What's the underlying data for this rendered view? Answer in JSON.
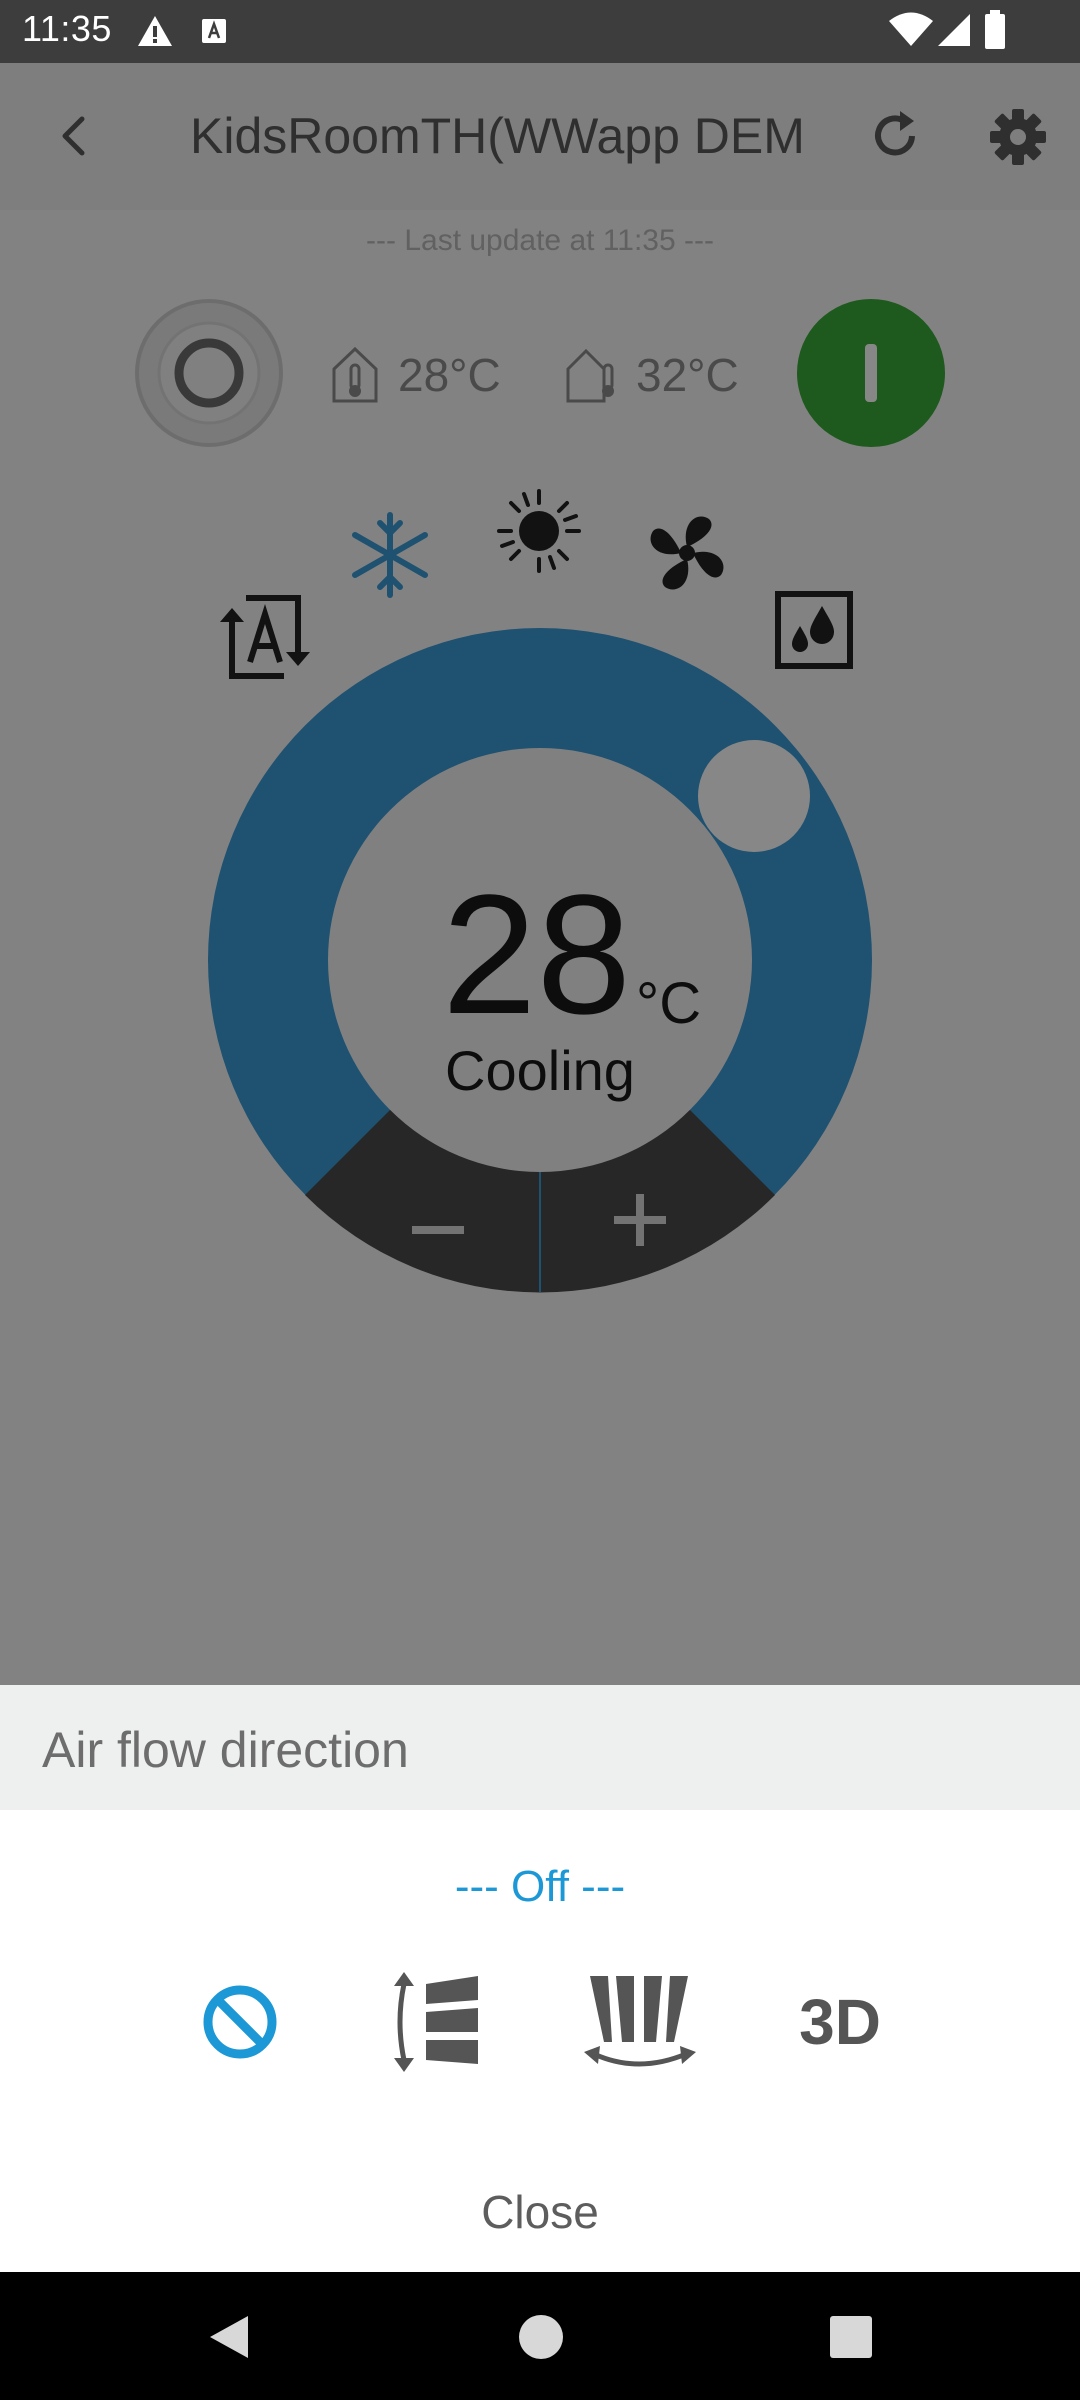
{
  "status_bar": {
    "time": "11:35"
  },
  "app_bar": {
    "title": "KidsRoomTH(WWapp DEM"
  },
  "main": {
    "last_update": "--- Last update at 11:35 ---",
    "indoor_temp": "28°C",
    "outdoor_temp": "32°C",
    "setpoint": "28",
    "unit": "°C",
    "mode_label": "Cooling",
    "selected_mode": "cool",
    "modes": [
      "auto",
      "cool",
      "heat",
      "fan",
      "dry"
    ],
    "colors": {
      "dial_blue": "#3b9ad4",
      "power_on_green": "#3aa93a",
      "dial_dark": "#4a4a4a"
    }
  },
  "airflow_sheet": {
    "title": "Air flow direction",
    "status": "--- Off ---",
    "options": [
      "off",
      "vertical-swing",
      "horizontal-swing",
      "3d"
    ],
    "option_3d_label": "3D",
    "close_label": "Close",
    "selected_color": "#1d98d6"
  }
}
